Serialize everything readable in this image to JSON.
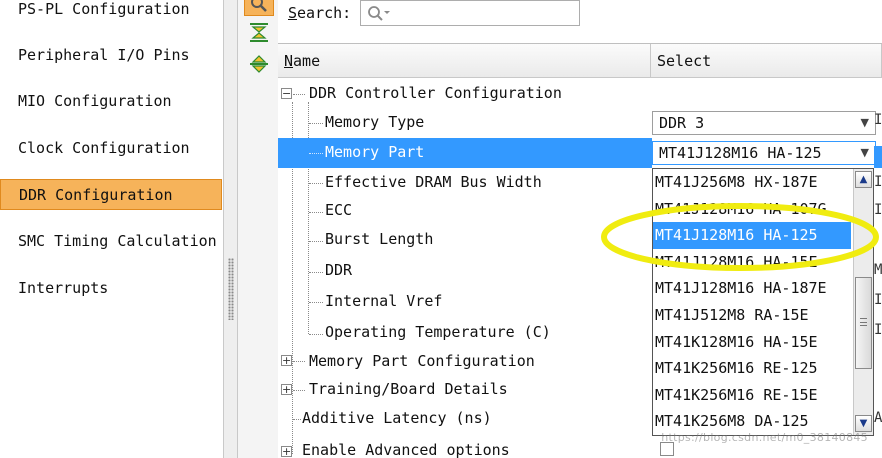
{
  "nav": {
    "items": [
      {
        "label": "PS-PL Configuration",
        "selected": false
      },
      {
        "label": "Peripheral I/O Pins",
        "selected": false
      },
      {
        "label": "MIO Configuration",
        "selected": false
      },
      {
        "label": "Clock Configuration",
        "selected": false
      },
      {
        "label": "DDR Configuration",
        "selected": true
      },
      {
        "label": "SMC Timing Calculation",
        "selected": false
      },
      {
        "label": "Interrupts",
        "selected": false
      }
    ]
  },
  "search": {
    "label_underlined": "S",
    "label_rest": "earch:",
    "value": ""
  },
  "table": {
    "headers": {
      "name_underlined": "N",
      "name_rest": "ame",
      "select": "Select"
    },
    "rows": {
      "ddr_controller": "DDR Controller Configuration",
      "memory_type": "Memory Type",
      "memory_part": "Memory Part",
      "effective_bus_width": "Effective DRAM Bus Width",
      "ecc": "ECC",
      "burst_length": "Burst Length",
      "ddr": "DDR",
      "internal_vref": "Internal Vref",
      "operating_temperature": "Operating Temperature (C)",
      "memory_part_config": "Memory Part Configuration",
      "training_board": "Training/Board Details",
      "additive_latency": "Additive Latency (ns)",
      "enable_advanced": "Enable Advanced options"
    },
    "values": {
      "memory_type": "DDR 3",
      "memory_part": "MT41J128M16 HA-125"
    }
  },
  "dropdown": {
    "items": [
      "MT41J256M8 HX-187E",
      "MT41J128M16 HA-107G",
      "MT41J128M16 HA-125",
      "MT41J128M16 HA-15E",
      "MT41J128M16 HA-187E",
      "MT41J512M8 RA-15E",
      "MT41K128M16 HA-15E",
      "MT41K256M16 RE-125",
      "MT41K256M16 RE-15E",
      "MT41K256M8 DA-125"
    ],
    "selected_index": 2
  },
  "edge_column": {
    "row1": "I",
    "row3": "I",
    "row4": "I",
    "row6": "M",
    "row7": "I",
    "row8": "I",
    "row11": "A"
  },
  "watermark": "https://blog.csdn.net/m0_38140845",
  "colors": {
    "nav_selected": "#f6b35a",
    "row_highlight": "#3399ff",
    "annotation": "#f0ec10"
  }
}
